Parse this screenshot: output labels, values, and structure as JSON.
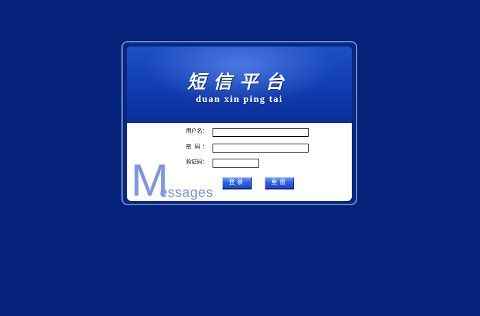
{
  "header": {
    "title_cn": "短信平台",
    "title_en": "duan xin ping tai"
  },
  "form": {
    "username_label": "用户名：",
    "password_label": "密  码 ：",
    "captcha_label": "验证码：",
    "username_value": "",
    "password_value": "",
    "captcha_value": ""
  },
  "buttons": {
    "login": "登录",
    "reset": "重置"
  },
  "watermark": {
    "big": "M",
    "small": "essages"
  },
  "colors": {
    "page_background": "#04227a",
    "header_blue": "#1240b5",
    "watermark": "#7f97df",
    "button_blue": "#2f63e3"
  }
}
